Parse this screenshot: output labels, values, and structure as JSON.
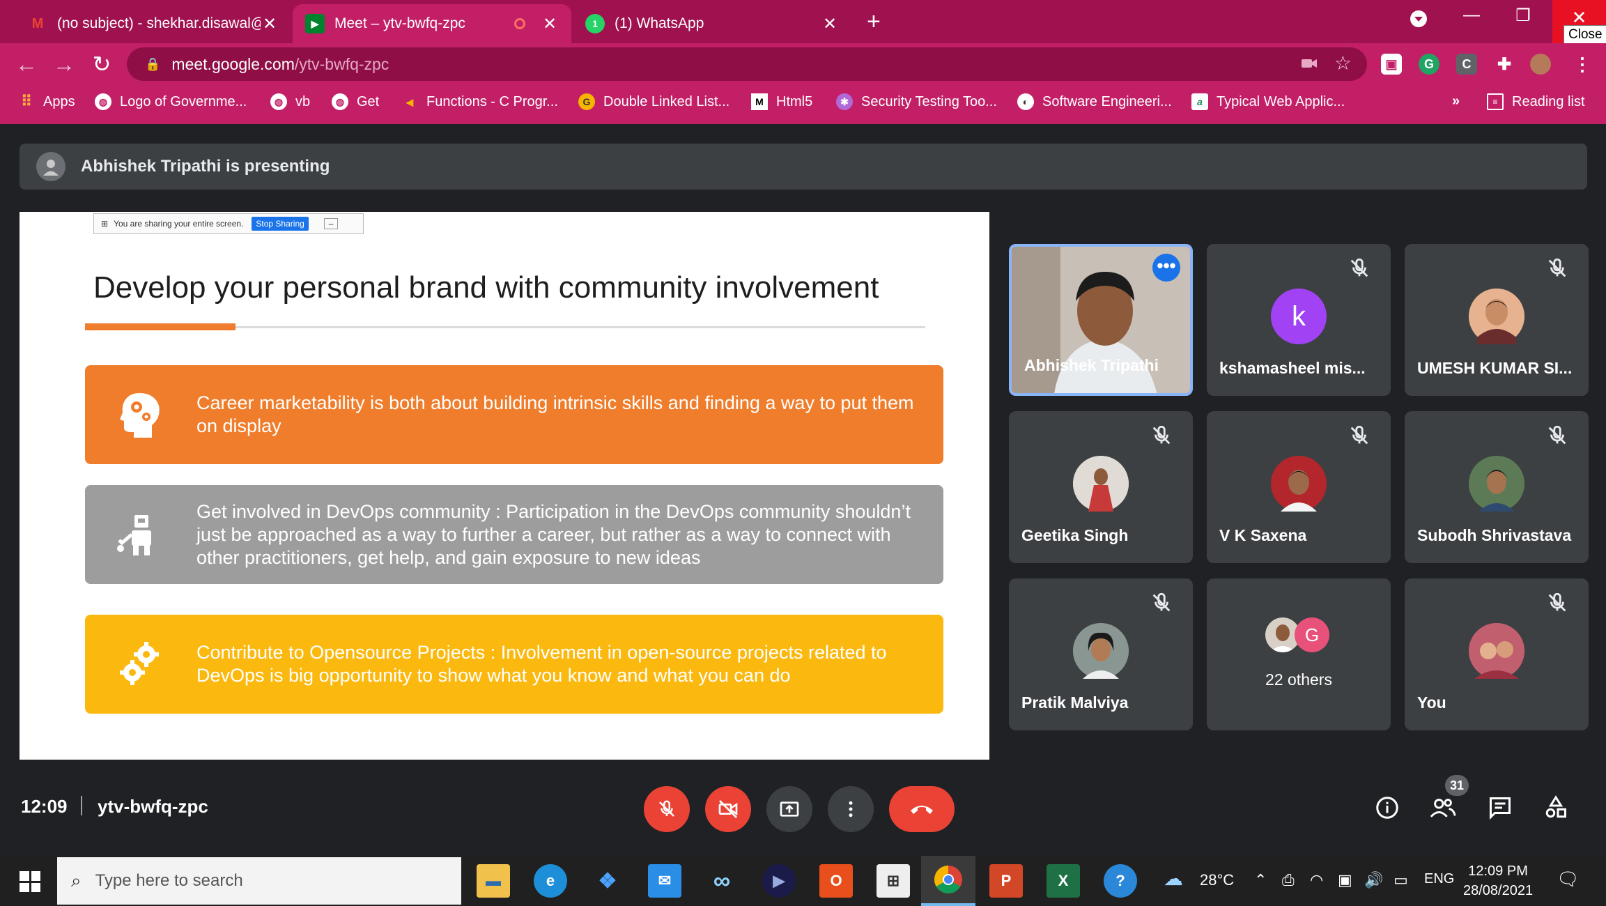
{
  "browser": {
    "tabs": [
      {
        "title": "(no subject) - shekhar.disawal@g",
        "icon": "gmail-icon"
      },
      {
        "title": "Meet – ytv-bwfq-zpc",
        "icon": "meet-icon"
      },
      {
        "title": "(1) WhatsApp",
        "icon": "whatsapp-icon"
      }
    ],
    "close_tooltip": "Close",
    "url_host": "meet.google.com",
    "url_path": "/ytv-bwfq-zpc",
    "bookmarks": [
      "Apps",
      "Logo of Governme...",
      "vb",
      "Get",
      "Functions - C Progr...",
      "Double Linked List...",
      "Html5",
      "Security Testing Too...",
      "Software Engineeri...",
      "Typical Web Applic..."
    ],
    "more_bookmarks": "»",
    "reading_list": "Reading list"
  },
  "meet": {
    "presenting_text": "Abhishek Tripathi is presenting",
    "slide": {
      "share_notice": "You are sharing your entire screen.",
      "stop_sharing": "Stop Sharing",
      "title": "Develop your personal brand with community involvement",
      "cards": [
        {
          "text": "Career marketability is both about building intrinsic skills and finding a way to put them on display",
          "color": "#ef7d2b"
        },
        {
          "text": "Get involved in DevOps community : Participation in the DevOps community shouldn’t just be approached as a way to further a career, but rather as a way to connect with other practitioners, get help, and gain exposure to new ideas",
          "color": "#9d9d9d"
        },
        {
          "text": "Contribute to Opensource Projects : Involvement in open-source projects related to DevOps is big opportunity to show what you know and what you can do",
          "color": "#fbb90f"
        }
      ]
    },
    "participants": [
      {
        "name": "Abhishek Tripathi"
      },
      {
        "name": "kshamasheel mis...",
        "initial": "k"
      },
      {
        "name": "UMESH KUMAR SI..."
      },
      {
        "name": "Geetika Singh"
      },
      {
        "name": "V K Saxena"
      },
      {
        "name": "Subodh Shrivastava"
      },
      {
        "name": "Pratik Malviya"
      },
      {
        "name": "22 others",
        "initial": "G"
      },
      {
        "name": "You"
      }
    ],
    "time": "12:09",
    "meeting_code": "ytv-bwfq-zpc",
    "participant_count": "31"
  },
  "taskbar": {
    "search_placeholder": "Type here to search",
    "weather": "28°C",
    "language": "ENG",
    "time": "12:09 PM",
    "date": "28/08/2021"
  }
}
